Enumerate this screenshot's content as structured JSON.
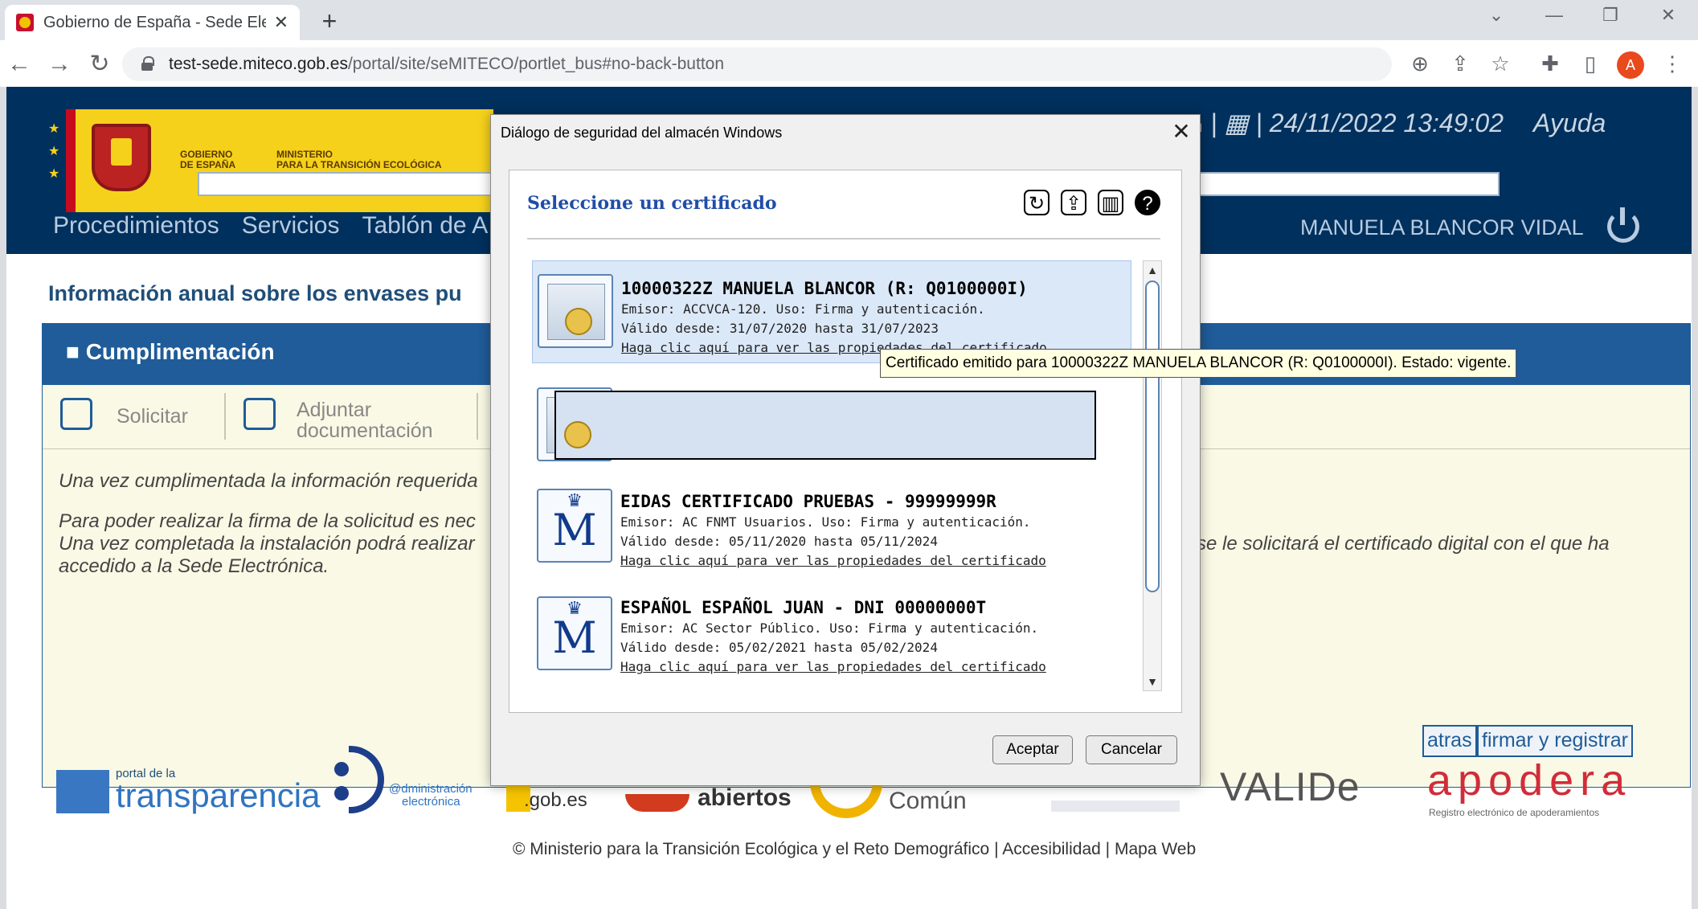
{
  "browser": {
    "tab_title": "Gobierno de España - Sede Electrónica",
    "tab_close": "✕",
    "new_tab": "+",
    "url_host": "test-sede.miteco.gob.es",
    "url_path": "/portal/site/seMITECO/portlet_bus#no-back-button",
    "profile_initial": "A"
  },
  "page": {
    "logo_line1": "GOBIERNO",
    "logo_line2": "DE ESPAÑA",
    "logo_line3": "MINISTERIO",
    "logo_line4": "PARA LA TRANSICIÓN ECOLÓGICA",
    "datetime": "24/11/2022 13:49:02",
    "help": "Ayuda",
    "separator": "|",
    "nav": [
      "Procedimientos",
      "Servicios",
      "Tablón de A"
    ],
    "user": "MANUELA BLANCOR VIDAL",
    "info_title": "Información anual sobre los envases pu",
    "section_title": "Cumplimentación",
    "steps": {
      "solicitar": "Solicitar",
      "adjuntar_1": "Adjuntar",
      "adjuntar_2": "documentación"
    },
    "para1": "Una vez cumplimentada la información requerida",
    "para2_1": "Para poder realizar la firma de la solicitud es nec",
    "para2_2": "Una vez completada la instalación podrá realizar",
    "para2_3": "accedido a la Sede Electrónica.",
    "para2_right": "se le solicitará el certificado digital con el que ha",
    "btn_atras": "atras",
    "btn_firmar": "firmar y registrar",
    "footer_logos": {
      "portal": "portal de la",
      "transparencia": "transparencia",
      "admin": "@dministración",
      "electronica": "electrónica",
      "gob": ".gob.es",
      "abiertos": "abiertos",
      "comun": "Común",
      "valide": "VALIDe",
      "apodera": "apodera",
      "apodera_sub": "Registro electrónico de apoderamientos"
    },
    "copyright": "© Ministerio para la Transición Ecológica y el Reto Demográfico",
    "accesibilidad": "Accesibilidad",
    "mapa": "Mapa Web"
  },
  "dialog": {
    "title": "Diálogo de seguridad del almacén Windows",
    "close": "✕",
    "heading": "Seleccione un certificado",
    "certs": [
      {
        "name": "10000322Z MANUELA BLANCOR (R: Q0100000I)",
        "issuer": "Emisor: ACCVCA-120. Uso: Firma y autenticación.",
        "valid": "Válido desde: 31/07/2020 hasta 31/07/2023",
        "link": "Haga clic aquí para ver las propiedades del certificado"
      },
      {
        "name": "EIDAS CERTIFICADO PRUEBAS - 99999999R",
        "issuer": "Emisor: AC FNMT Usuarios. Uso: Firma y autenticación.",
        "valid": "Válido desde: 05/11/2020 hasta 05/11/2024",
        "link": "Haga clic aquí para ver las propiedades del certificado"
      },
      {
        "name": "ESPAÑOL ESPAÑOL JUAN - DNI 00000000T",
        "issuer": "Emisor: AC Sector Público. Uso: Firma y autenticación.",
        "valid": "Válido desde: 05/02/2021 hasta 05/02/2024",
        "link": "Haga clic aquí para ver las propiedades del certificado"
      }
    ],
    "tooltip": "Certificado emitido para 10000322Z MANUELA BLANCOR (R: Q0100000I). Estado: vigente.",
    "accept": "Aceptar",
    "cancel": "Cancelar"
  }
}
